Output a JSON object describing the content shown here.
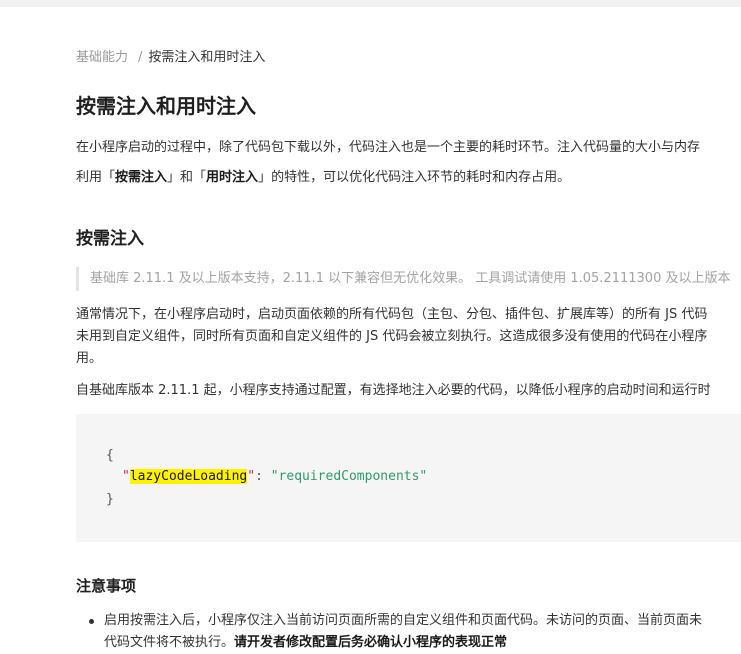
{
  "breadcrumb": {
    "parent": "基础能力",
    "separator": "/",
    "current": "按需注入和用时注入"
  },
  "title": "按需注入和用时注入",
  "intro": {
    "line1": "在小程序启动的过程中，除了代码包下载以外，代码注入也是一个主要的耗时环节。注入代码量的大小与内存",
    "line2_prefix": "利用「",
    "line2_bold1": "按需注入",
    "line2_mid": "」和「",
    "line2_bold2": "用时注入",
    "line2_suffix": "」的特性，可以优化代码注入环节的耗时和内存占用。"
  },
  "section": {
    "heading": "按需注入",
    "note": "基础库 2.11.1 及以上版本支持，2.11.1 以下兼容但无优化效果。 工具调试请使用 1.05.2111300 及以上版本",
    "para1_line1": "通常情况下，在小程序启动时，启动页面依赖的所有代码包（主包、分包、插件包、扩展库等）的所有 JS 代码",
    "para1_line2": "未用到自定义组件，同时所有页面和自定义组件的 JS 代码会被立刻执行。这造成很多没有使用的代码在小程序",
    "para1_line3": "用。",
    "para2": "自基础库版本 2.11.1 起，小程序支持通过配置，有选择地注入必要的代码，以降低小程序的启动时间和运行时"
  },
  "code": {
    "open": "{",
    "quote": "\"",
    "key": "lazyCodeLoading",
    "colon": ": ",
    "value": "\"requiredComponents\"",
    "close": "}"
  },
  "notes": {
    "heading": "注意事项",
    "item1_line1": "启用按需注入后，小程序仅注入当前访问页面所需的自定义组件和页面代码。未访问的页面、当前页面未",
    "item1_line2_normal": "代码文件将不被执行。",
    "item1_line2_bold": "请开发者修改配置后务必确认小程序的表现正常"
  }
}
